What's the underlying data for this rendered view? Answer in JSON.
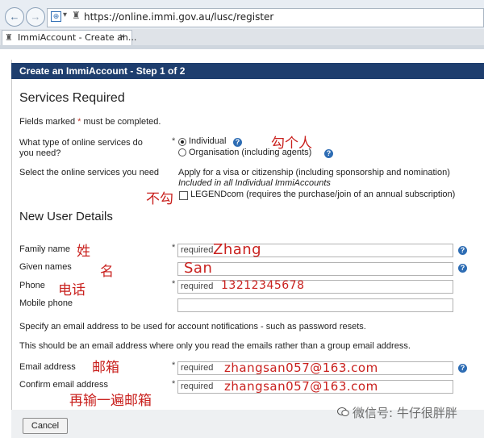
{
  "browser": {
    "url": "https://online.immi.gov.au/lusc/register",
    "tab_title": "ImmiAccount - Create an...",
    "tab_close": "×"
  },
  "page": {
    "step_title": "Create an ImmiAccount - Step 1 of 2",
    "services": {
      "title": "Services Required",
      "fields_note_prefix": "Fields marked",
      "fields_note_suffix": "must be completed.",
      "question_line1": "What type of online services do",
      "question_line2": "you need?",
      "option_individual": "Individual",
      "option_organisation": "Organisation (including agents)",
      "select_label": "Select the online services you need",
      "visa_line": "Apply for a visa or citizenship (including sponsorship and nomination)",
      "included_line": "Included in all Individual ImmiAccounts",
      "legend_line": "LEGENDcom (requires the purchase/join of an annual subscription)"
    },
    "user": {
      "title": "New User Details",
      "family_name_label": "Family name",
      "given_names_label": "Given names",
      "phone_label": "Phone",
      "mobile_label": "Mobile phone",
      "email_note1": "Specify an email address to be used for account notifications - such as password resets.",
      "email_note2": "This should be an email address where only you read the emails rather than a group email address.",
      "email_label": "Email address",
      "confirm_email_label": "Confirm email address",
      "required_placeholder": "required",
      "family_name_value": "Zhang",
      "given_names_value": "San",
      "phone_value": "13212345678",
      "email_value": "zhangsan057@163.com",
      "confirm_email_value": "zhangsan057@163.com"
    },
    "cancel_label": "Cancel"
  },
  "annotations": {
    "tick_individual": "勾个人",
    "no_tick": "不勾",
    "surname": "姓",
    "given": "名",
    "phone": "电话",
    "email": "邮箱",
    "repeat_email": "再输一遍邮箱"
  },
  "watermark": "微信号: 牛仔很胖胖",
  "colors": {
    "header_bg": "#1e3e6e",
    "annotation": "#c9211e",
    "help_icon": "#2e6db4",
    "required_star": "#c0392b"
  }
}
